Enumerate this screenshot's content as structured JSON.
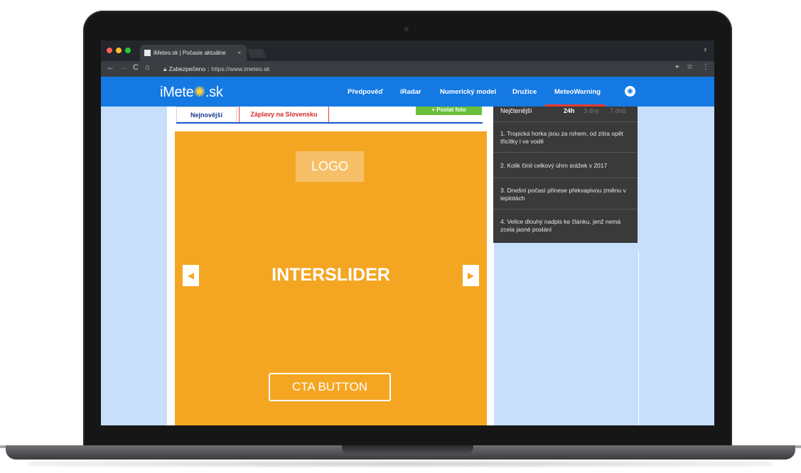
{
  "browser": {
    "tab_title": "iMeteo.sk | Počasie aktuálne",
    "tab_close": "×",
    "nav_back": "←",
    "nav_forward": "→",
    "nav_reload": "C",
    "nav_home": "⌂",
    "secure_label": "Zabezpečeno",
    "url": "https://www.imeteo.sk",
    "incognito_icon": "♁",
    "right_icons": [
      "⌖",
      "☆",
      "⋮"
    ]
  },
  "site": {
    "logo_text_left": "iMete",
    "logo_sun": "✺",
    "logo_text_right": ".sk",
    "nav": [
      "Předpověď",
      "iRadar",
      "Numerický model",
      "Družice",
      "MeteoWarning"
    ],
    "user_icon": "◉"
  },
  "subtabs": {
    "latest": "Nejnovější",
    "floods": "Záplavy na Slovensku",
    "add_photo": "+ Poslat foto"
  },
  "hero": {
    "logo_label": "LOGO",
    "title": "INTERSLIDER",
    "prev_icon": "◀",
    "next_icon": "▶",
    "cta_label": "CTA BUTTON"
  },
  "most_read": {
    "title": "Nejčtenější",
    "periods": [
      "24h",
      "3 dny",
      "7 dnů"
    ],
    "items": [
      "1. Tropická horka jsou za rohem, od zítra opět třicítky i ve vodě",
      "2. Kolik činil celkový úhrn srážek v 2017",
      "3. Dnešní počasí přinese překvapivou změnu v teplotách",
      "4. Velice dlouhý nadpis ke článku, jenž nemá zcela jasné poslání"
    ]
  }
}
